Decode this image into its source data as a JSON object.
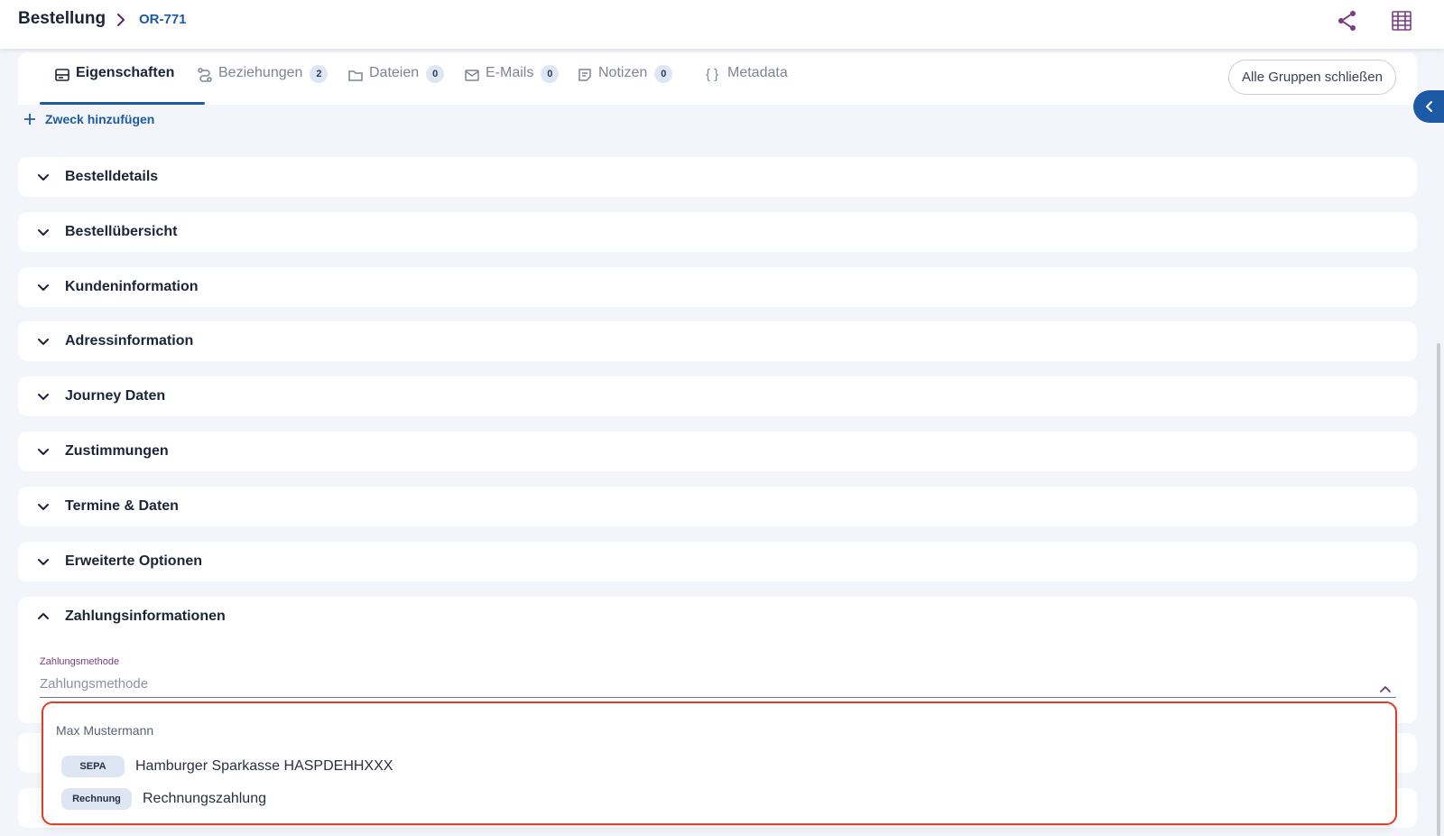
{
  "header": {
    "breadcrumb_root": "Bestellung",
    "breadcrumb_current": "OR-771",
    "share_icon": "share-icon",
    "grid_icon": "grid-icon"
  },
  "tabs": [
    {
      "label": "Eigenschaften",
      "icon": "properties-icon",
      "active": true
    },
    {
      "label": "Beziehungen",
      "icon": "relations-icon",
      "count": "2"
    },
    {
      "label": "Dateien",
      "icon": "folder-icon",
      "count": "0"
    },
    {
      "label": "E-Mails",
      "icon": "mail-icon",
      "count": "0"
    },
    {
      "label": "Notizen",
      "icon": "notes-icon",
      "count": "0"
    },
    {
      "label": "Metadata",
      "icon": "braces-icon"
    }
  ],
  "actions": {
    "close_groups": "Alle Gruppen schließen",
    "add_purpose": "Zweck hinzufügen"
  },
  "groups": [
    "Bestelldetails",
    "Bestellübersicht",
    "Kundeninformation",
    "Adressinformation",
    "Journey Daten",
    "Zustimmungen",
    "Termine & Daten",
    "Erweiterte Optionen"
  ],
  "payment_group": {
    "title": "Zahlungsinformationen",
    "field_label": "Zahlungsmethode",
    "field_placeholder": "Zahlungsmethode"
  },
  "dropdown": {
    "header": "Max Mustermann",
    "options": [
      {
        "tag": "SEPA",
        "text": "Hamburger Sparkasse HASPDEHHXXX"
      },
      {
        "tag": "Rechnung",
        "text": "Rechnungszahlung"
      }
    ]
  },
  "colors": {
    "accent": "#1d5aa5",
    "highlight_border": "#e03d25",
    "field_label": "#7a3b83"
  }
}
